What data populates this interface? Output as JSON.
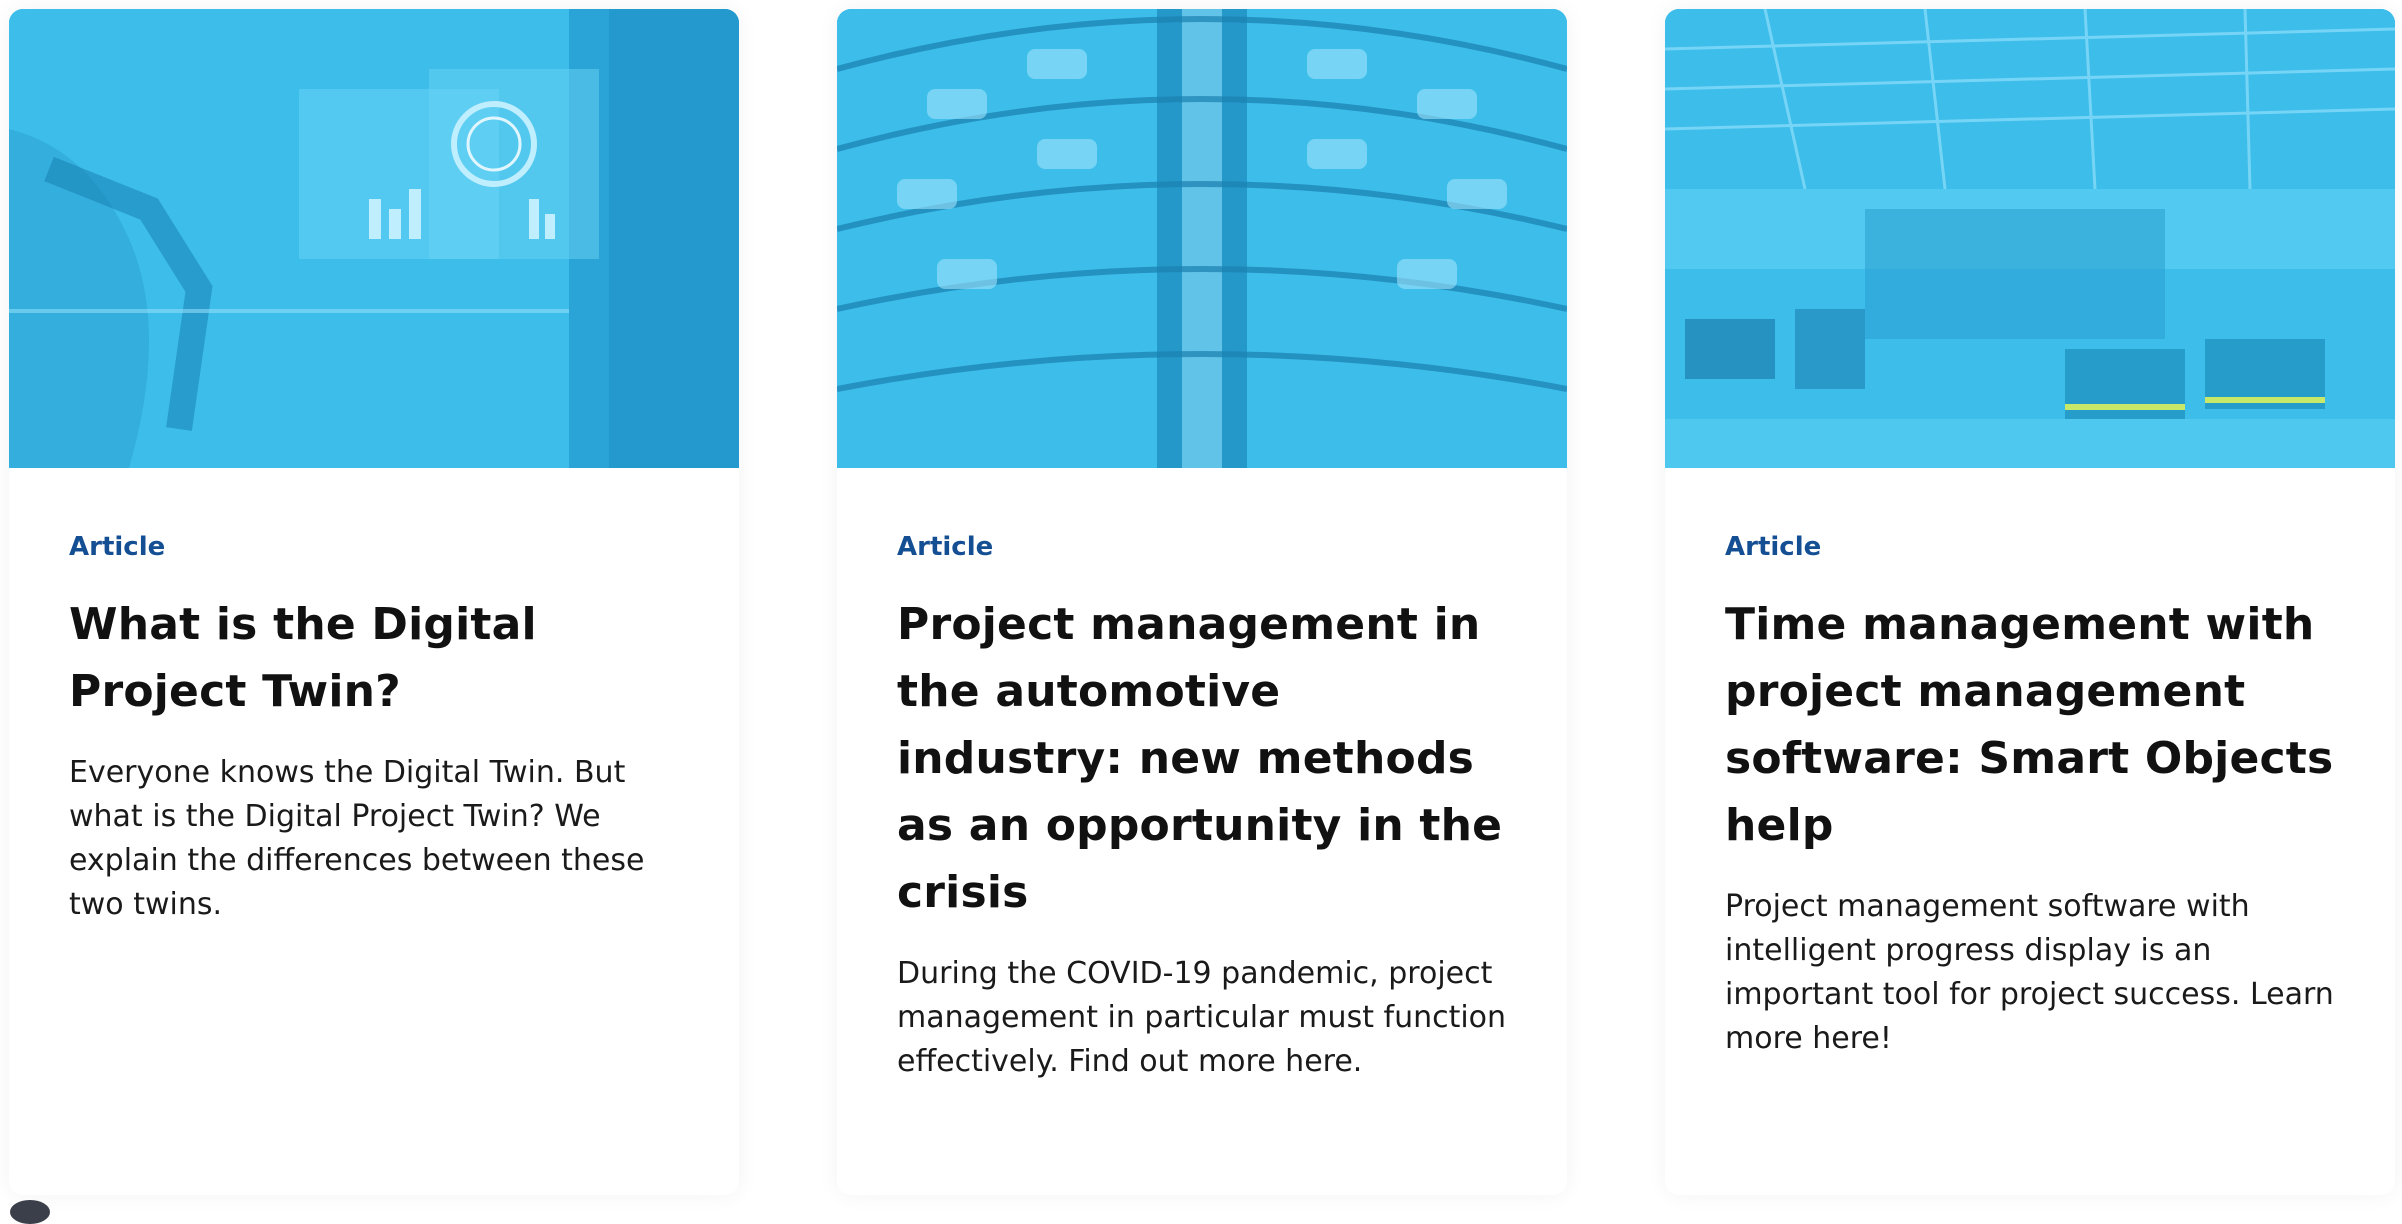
{
  "cards": [
    {
      "tag": "Article",
      "title": "What is the Digital Project Twin?",
      "description": "Everyone knows the Digital Twin. But what is the Digital Project Twin? We explain the differences between these two twins.",
      "image_theme": "digital-twin-dashboard"
    },
    {
      "tag": "Article",
      "title": "Project management in the automotive industry: new methods as an opportunity in the crisis",
      "description": "During the COVID-19 pandemic, project management in particular must function effectively. Find out more here.",
      "image_theme": "car-tower"
    },
    {
      "tag": "Article",
      "title": "Time management with project management software: Smart Objects help",
      "description": "Project management software with intelligent progress display is an important tool for project success. Learn more here!",
      "image_theme": "factory-hall"
    }
  ],
  "colors": {
    "tag": "#144e93",
    "image_tint": "#3cbdea",
    "title": "#111111",
    "text": "#1a1a1a"
  }
}
